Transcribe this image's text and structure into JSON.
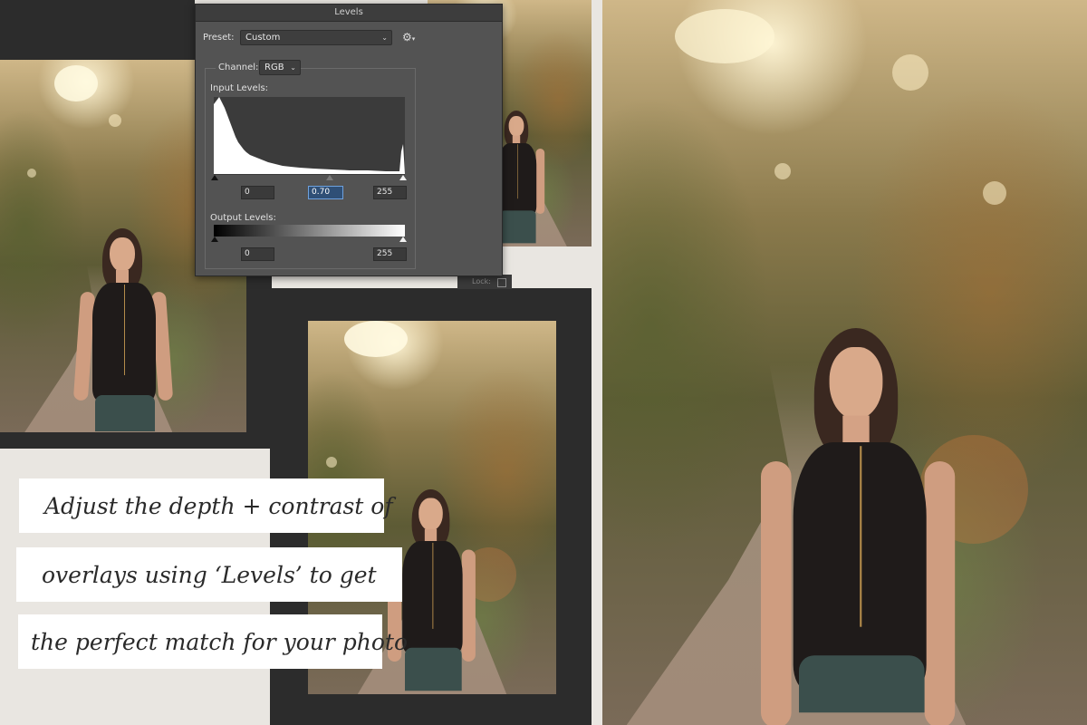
{
  "dialog": {
    "title": "Levels",
    "preset_label": "Preset:",
    "preset_value": "Custom",
    "channel_label": "Channel:",
    "channel_value": "RGB",
    "input_levels_label": "Input Levels:",
    "input_black": "0",
    "input_gamma": "0.70",
    "input_white": "255",
    "output_levels_label": "Output Levels:",
    "output_black": "0",
    "output_white": "255",
    "gear_icon": "gear-icon",
    "histogram_fill": "#ffffff",
    "histogram_bg": "#3b3b3b"
  },
  "panel_lock_label": "Lock:",
  "captions": {
    "line1": "Adjust the depth + contrast of",
    "line2": "overlays using ‘Levels’ to get",
    "line3": "the perfect match for your photo"
  },
  "colors": {
    "app_dark": "#2c2c2c",
    "paper": "#e9e6e1",
    "dialog_bg": "#535353",
    "selection_blue": "#2f4f76"
  }
}
